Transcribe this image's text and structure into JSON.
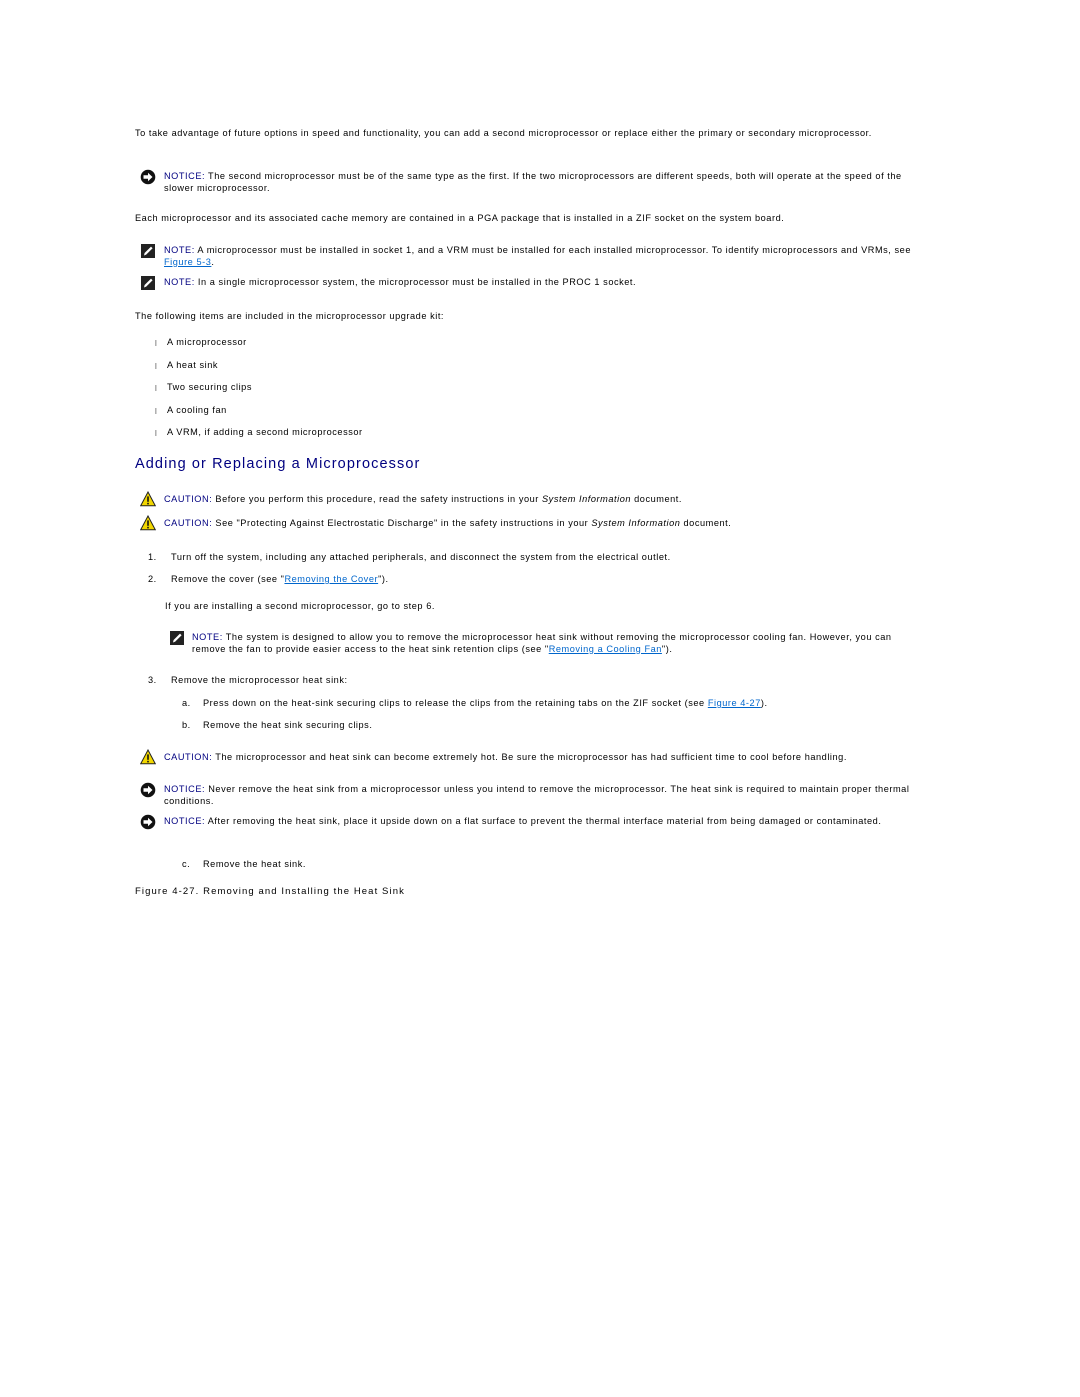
{
  "intro": {
    "para1": "To take advantage of future options in speed and functionality, you can add a second microprocessor or replace either the primary or secondary microprocessor.",
    "notice1": {
      "label": "NOTICE:",
      "text": " The second microprocessor must be of the same type as the first. If the two microprocessors are different speeds, both will operate at the speed of the slower microprocessor.",
      "icon": "notice-arrow-icon"
    },
    "para2": "Each microprocessor and its associated cache memory are contained in a PGA package that is installed in a ZIF socket on the system board.",
    "note1": {
      "label": "NOTE:",
      "text_before": " A microprocessor must be installed in socket 1, and a VRM must be installed for each installed microprocessor. To identify microprocessors and VRMs, see ",
      "link": "Figure 5-3",
      "text_after": ".",
      "icon": "note-pencil-icon"
    },
    "note2": {
      "label": "NOTE:",
      "text": " In a single microprocessor system, the microprocessor must be installed in the PROC 1 socket.",
      "icon": "note-pencil-icon"
    },
    "kit_intro": "The following items are included in the microprocessor upgrade kit:",
    "kit_items": [
      "A microprocessor",
      "A heat sink",
      "Two securing clips",
      "A cooling fan",
      "A VRM, if adding a second microprocessor"
    ],
    "bullet_glyph": "l"
  },
  "section": {
    "heading": "Adding or Replacing a Microprocessor",
    "caution1": {
      "label": "CAUTION:",
      "text_before": " Before you perform this procedure, read the safety instructions in your ",
      "em": "System Information",
      "text_after": " document.",
      "icon": "caution-triangle-icon"
    },
    "caution2": {
      "label": "CAUTION:",
      "text_before": " See \"Protecting Against Electrostatic Discharge\" in the safety instructions in your ",
      "em": "System Information",
      "text_after": " document.",
      "icon": "caution-triangle-icon"
    },
    "steps": [
      {
        "num": "1.",
        "text": "Turn off the system, including any attached peripherals, and disconnect the system from the electrical outlet."
      },
      {
        "num": "2.",
        "text_before": "Remove the cover (see \"",
        "link": "Removing the Cover",
        "text_after": "\")."
      },
      {
        "num": "3.",
        "text": "Remove the microprocessor heat sink:"
      }
    ],
    "step2_followup": "If you are installing a second microprocessor, go to step 6.",
    "note3": {
      "label": "NOTE:",
      "text_before": " The system is designed to allow you to remove the microprocessor heat sink without removing the microprocessor cooling fan. However, you can remove the fan to provide easier access to the heat sink retention clips (see \"",
      "link": "Removing a Cooling Fan",
      "text_after": "\").",
      "icon": "note-pencil-icon"
    },
    "substeps": [
      {
        "num": "a.",
        "text_before": "Press down on the heat-sink securing clips to release the clips from the retaining tabs on the ZIF socket (see ",
        "link": "Figure 4-27",
        "text_after": ")."
      },
      {
        "num": "b.",
        "text": "Remove the heat sink securing clips."
      },
      {
        "num": "c.",
        "text": "Remove the heat sink."
      }
    ],
    "caution3": {
      "label": "CAUTION:",
      "text": " The microprocessor and heat sink can become extremely hot. Be sure the microprocessor has had sufficient time to cool before handling.",
      "icon": "caution-triangle-icon"
    },
    "notice2": {
      "label": "NOTICE:",
      "text": " Never remove the heat sink from a microprocessor unless you intend to remove the microprocessor. The heat sink is required to maintain proper thermal conditions.",
      "icon": "notice-arrow-icon"
    },
    "notice3": {
      "label": "NOTICE:",
      "text": " After removing the heat sink, place it upside down on a flat surface to prevent the thermal interface material from being damaged or contaminated.",
      "icon": "notice-arrow-icon"
    },
    "figure_caption": "Figure 4-27. Removing and Installing the Heat Sink"
  },
  "colors": {
    "label_blue": "#000080",
    "link_blue": "#0066cc",
    "caution_yellow": "#f2d700"
  }
}
